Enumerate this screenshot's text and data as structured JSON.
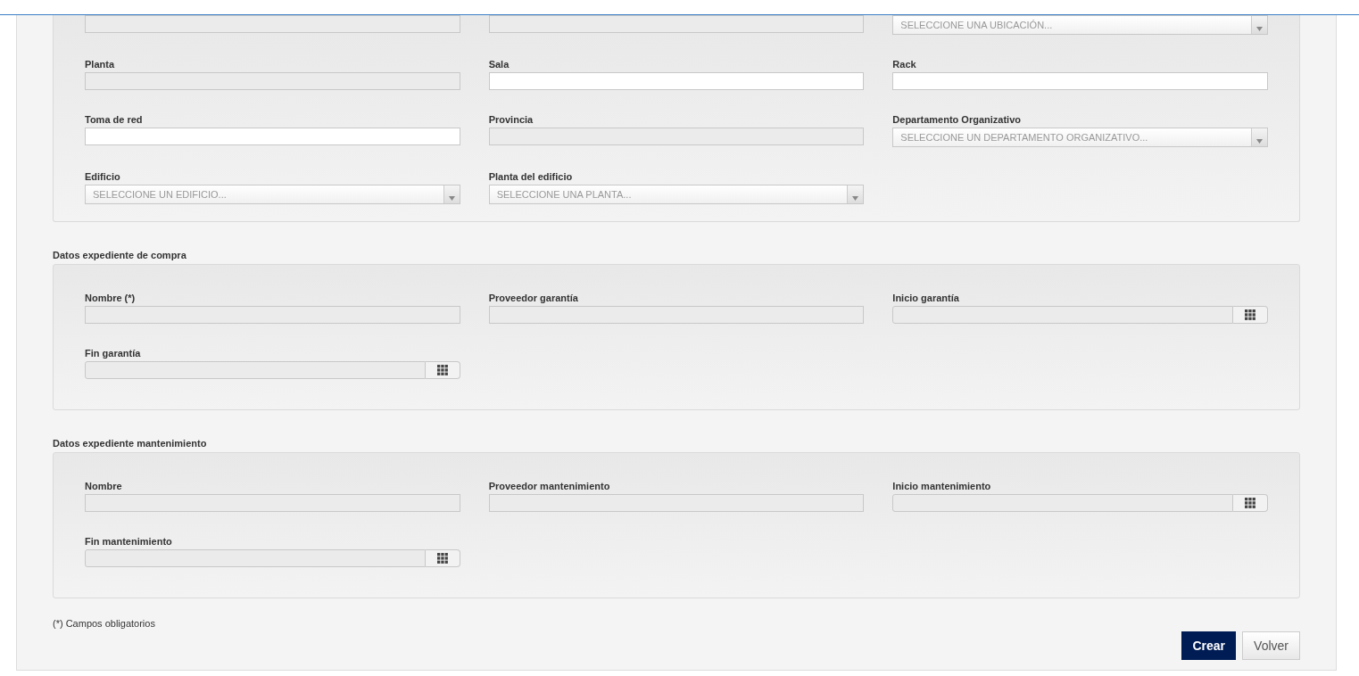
{
  "sections": [
    {
      "rows": [
        [
          {
            "kind": "readonly"
          },
          {
            "kind": "readonly"
          },
          {
            "kind": "select",
            "placeholder": "SELECCIONE UNA UBICACIÓN..."
          }
        ],
        [
          {
            "label": "Planta",
            "kind": "readonly"
          },
          {
            "label": "Sala",
            "kind": "text"
          },
          {
            "label": "Rack",
            "kind": "text"
          }
        ],
        [
          {
            "label": "Toma de red",
            "kind": "text"
          },
          {
            "label": "Provincia",
            "kind": "readonly"
          },
          {
            "label": "Departamento Organizativo",
            "kind": "select",
            "placeholder": "SELECCIONE UN DEPARTAMENTO ORGANIZATIVO..."
          }
        ],
        [
          {
            "label": "Edificio",
            "kind": "select",
            "placeholder": "SELECCIONE UN EDIFICIO..."
          },
          {
            "label": "Planta del edificio",
            "kind": "select",
            "placeholder": "SELECCIONE UNA PLANTA..."
          }
        ]
      ]
    },
    {
      "title": "Datos expediente de compra",
      "rows": [
        [
          {
            "label": "Nombre (*)",
            "kind": "readonly"
          },
          {
            "label": "Proveedor garantía",
            "kind": "readonly"
          },
          {
            "label": "Inicio garantía",
            "kind": "date"
          }
        ],
        [
          {
            "label": "Fin garantía",
            "kind": "date"
          }
        ]
      ]
    },
    {
      "title": "Datos expediente mantenimiento",
      "rows": [
        [
          {
            "label": "Nombre",
            "kind": "readonly"
          },
          {
            "label": "Proveedor mantenimiento",
            "kind": "readonly"
          },
          {
            "label": "Inicio mantenimiento",
            "kind": "date"
          }
        ],
        [
          {
            "label": "Fin mantenimiento",
            "kind": "date"
          }
        ]
      ]
    }
  ],
  "footnote": "(*) Campos obligatorios",
  "buttons": [
    {
      "label": "Crear",
      "kind": "primary"
    },
    {
      "label": "Volver",
      "kind": "secondary"
    }
  ]
}
